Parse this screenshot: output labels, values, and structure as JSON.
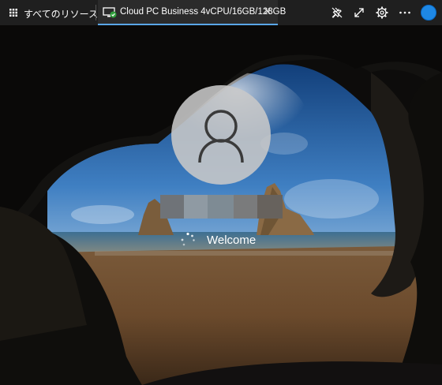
{
  "tabs": {
    "all_resources_label": "すべてのリソース",
    "active_label": "Cloud PC Business 4vCPU/16GB/128GB",
    "close_glyph": "✕"
  },
  "toolbar": {
    "icons": [
      "pin-off-icon",
      "expand-icon",
      "gear-icon",
      "more-icon",
      "account-avatar"
    ]
  },
  "login": {
    "welcome_text": "Welcome"
  },
  "colors": {
    "tab_underline": "#5aa7e8",
    "avatar": "#1e88e5"
  }
}
